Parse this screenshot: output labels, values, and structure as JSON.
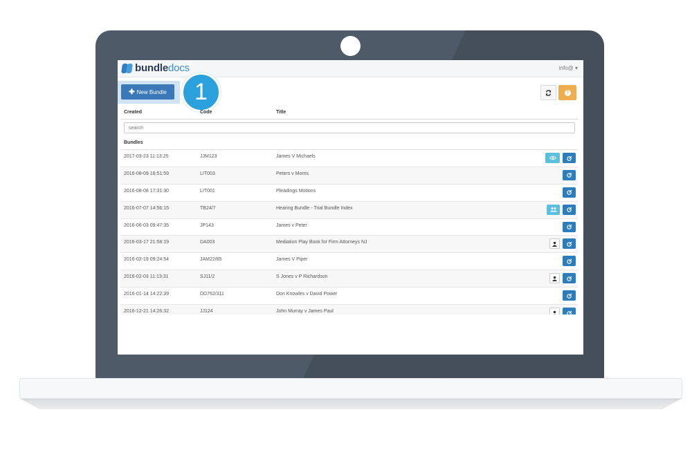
{
  "app": {
    "logo_part1": "bundle",
    "logo_part2": "docs",
    "user_menu": "info@ ▾"
  },
  "toolbar": {
    "new_bundle_plus": "✚",
    "new_bundle_label": "New Bundle",
    "step_number": "1",
    "refresh_icon": "refresh-icon",
    "help_icon": "help-icon"
  },
  "table": {
    "columns": [
      "Created",
      "Code",
      "Title"
    ],
    "search_placeholder": "search",
    "section_label": "Bundles",
    "rows": [
      {
        "created": "2017-03-23 11:13:25",
        "code": "JJM123",
        "title": "James V Michaels",
        "actions": [
          "eye",
          "edit"
        ]
      },
      {
        "created": "2016-08-09 16:51:59",
        "code": "LIT003",
        "title": "Peters v Morris",
        "actions": [
          "edit"
        ]
      },
      {
        "created": "2016-08-08 17:31:30",
        "code": "LIT001",
        "title": "Pleadings Motions",
        "actions": [
          "edit"
        ]
      },
      {
        "created": "2016-07-07 14:56:15",
        "code": "TB24/7",
        "title": "Hearing Bundle - Trial Bundle Index",
        "actions": [
          "people",
          "edit"
        ]
      },
      {
        "created": "2016-06-03 09:47:35",
        "code": "JP143",
        "title": "James v Peter",
        "actions": [
          "edit"
        ]
      },
      {
        "created": "2016-03-17 21:58:19",
        "code": "DA003",
        "title": "Mediation Play Book for Firm Attorneys NJ",
        "actions": [
          "user",
          "edit"
        ]
      },
      {
        "created": "2016-02-19 09:24:54",
        "code": "JAM22/85",
        "title": "James V Piper",
        "actions": [
          "edit"
        ]
      },
      {
        "created": "2016-02-03 11:13:31",
        "code": "SJ11/2",
        "title": "S Jones v P Richardson",
        "actions": [
          "user",
          "edit"
        ]
      },
      {
        "created": "2016-01-14 14:22:39",
        "code": "DD762/311",
        "title": "Don Knowles v David Power",
        "actions": [
          "edit"
        ]
      },
      {
        "created": "2016-12-21 14:26:32",
        "code": "JJ124",
        "title": "John Murray v James Paul",
        "actions": [
          "user",
          "edit"
        ]
      }
    ]
  },
  "colors": {
    "primary": "#3a78b8",
    "accent_badge": "#2aa0dc",
    "help": "#f0ad4e",
    "info": "#5bc0de",
    "bezel": "#4e5a67"
  }
}
